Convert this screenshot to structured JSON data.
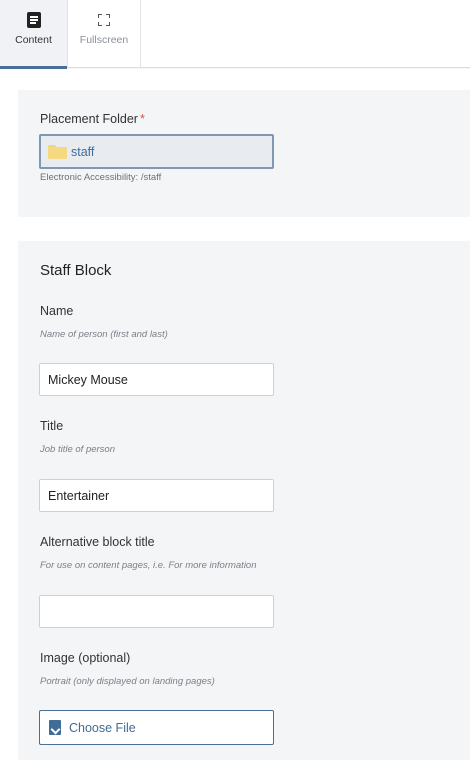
{
  "toolbar": {
    "tabs": [
      {
        "label": "Content",
        "icon": "document-icon",
        "active": true
      },
      {
        "label": "Fullscreen",
        "icon": "expand-icon",
        "active": false
      }
    ]
  },
  "placement": {
    "label": "Placement Folder",
    "required_marker": "*",
    "folder_name": "staff",
    "path_text": "Electronic Accessibility: /staff"
  },
  "staff_block": {
    "title": "Staff Block",
    "name": {
      "label": "Name",
      "help": "Name of person (first and last)",
      "value": "Mickey Mouse"
    },
    "job_title": {
      "label": "Title",
      "help": "Job title of person",
      "value": "Entertainer"
    },
    "alt_title": {
      "label": "Alternative block title",
      "help": "For use on content pages, i.e. For more information",
      "value": ""
    },
    "image": {
      "label": "Image (optional)",
      "help": "Portrait (only displayed on landing pages)",
      "button_label": "Choose File"
    }
  },
  "colors": {
    "accent": "#4a6f94",
    "link": "#3f6d97",
    "required": "#d9534f",
    "panel_bg": "#f4f5f7"
  }
}
